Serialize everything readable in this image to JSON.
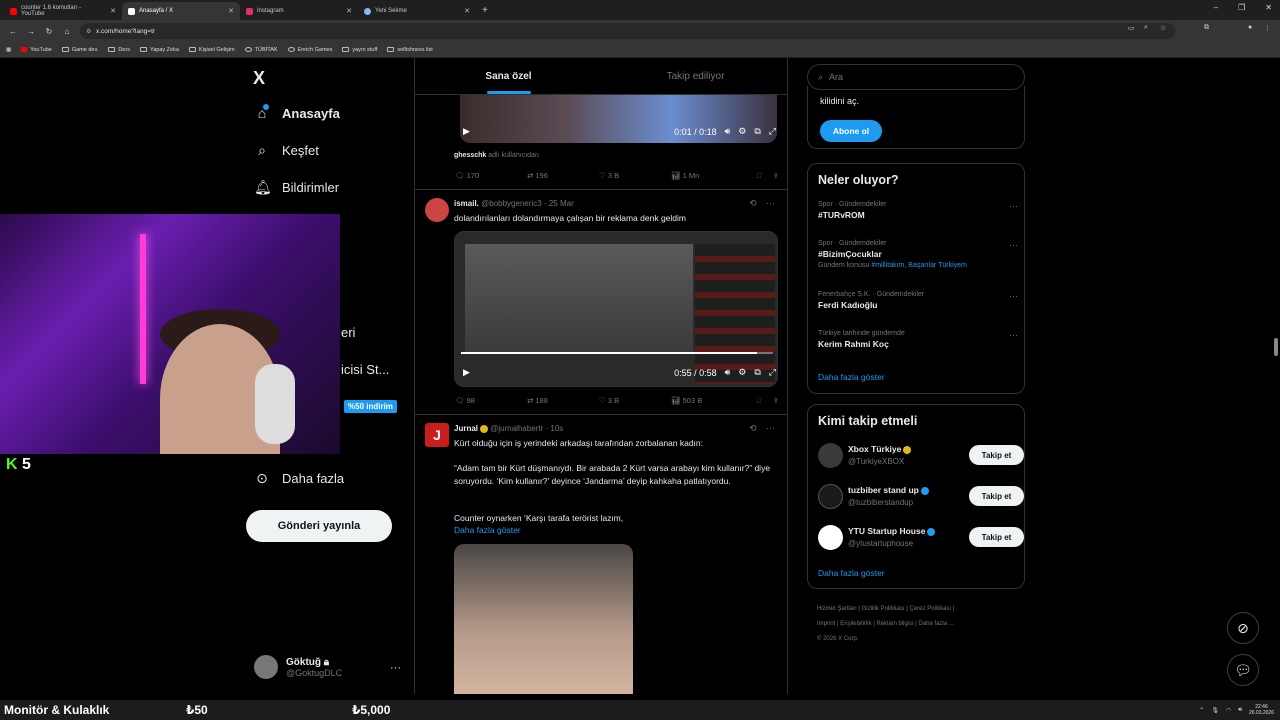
{
  "browser": {
    "tabs": [
      {
        "title": "counter 1.6 komutları - YouTube",
        "color": "#ff0000"
      },
      {
        "title": "Anasayfa / X",
        "color": "#ffffff"
      },
      {
        "title": "Instagram",
        "color": "#e1306c"
      },
      {
        "title": "Yeni Sekme",
        "color": "#8ab4f8"
      }
    ],
    "url": "x.com/home?lang=tr",
    "bookmarks": [
      "YouTube",
      "Game dev.",
      "Ders",
      "Yapay Zeka",
      "Kişisel Gelişim",
      "TÜBİTAK",
      "Enrich Games",
      "yayın stuff",
      "selfishness list"
    ]
  },
  "sidebar": {
    "logo": "X",
    "nav": [
      {
        "label": "Anasayfa",
        "icon": "home-icon"
      },
      {
        "label": "Keşfet",
        "icon": "search-icon"
      },
      {
        "label": "Bildirimler",
        "icon": "bell-icon"
      }
    ],
    "partial_1": "eri",
    "partial_2": "icisi St...",
    "promo_badge": "%50 indirim",
    "more": "Daha fazla",
    "post_button": "Gönderi yayınla",
    "account": {
      "name": "Göktuğ",
      "handle": "@GoktugDLC"
    }
  },
  "overlay": {
    "kick_value": "5"
  },
  "feed": {
    "tabs": [
      "Sana özel",
      "Takip ediliyor"
    ],
    "video1": {
      "time": "0:01 / 0:18",
      "attribution": "ghesschk",
      "attribution_suffix": "adlı kullanıcıdan",
      "progress": 0.05
    },
    "post1_stats": {
      "replies": "170",
      "reposts": "196",
      "likes": "3 B",
      "views": "1 Mn"
    },
    "post2": {
      "name": "ismail.",
      "handle": "@bobbygeneric3",
      "date": "25 Mar",
      "text": "dolandırılanları dolandırmaya çalışan bir reklama denk geldim",
      "video_time": "0:55 / 0:58",
      "progress": 0.95,
      "stats": {
        "replies": "98",
        "reposts": "188",
        "likes": "3 B",
        "views": "503 B"
      }
    },
    "post3": {
      "name": "Jurnal",
      "handle": "@jurnalhabertr",
      "time": "10s",
      "line1": "Kürt olduğu için iş yerindeki arkadaşı tarafından zorbalanan kadın:",
      "line2": "“Adam tam bir Kürt düşmanıydı. Bir arabada 2 Kürt varsa arabayı kim kullanır?” diye soruyordu. ‘Kim kullanır?’ deyince ‘Jandarma’ deyip kahkaha patlatıyordu.",
      "line3": "Counter oynarken ‘Karşı tarafa terörist lazım,",
      "show_more": "Daha fazla göster"
    }
  },
  "right": {
    "search_placeholder": "Ara",
    "premium_text": "kilidini aç.",
    "subscribe": "Abone ol",
    "trends_title": "Neler oluyor?",
    "trends": [
      {
        "category": "Spor · Gündemdekiler",
        "name": "#TURvROM",
        "extra": ""
      },
      {
        "category": "Spor · Gündemdekiler",
        "name": "#BizimÇocuklar",
        "extra_prefix": "Gündem konusu",
        "extra": "#millitakım, Başarılar Türkiyem"
      },
      {
        "category": "Fenerbahçe S.K. · Gündemdekiler",
        "name": "Ferdi Kadıoğlu",
        "extra": ""
      },
      {
        "category": "Türkiye tarihinde gündemde",
        "name": "Kerim Rahmi Koç",
        "extra": ""
      }
    ],
    "show_more": "Daha fazla göster",
    "who_title": "Kimi takip etmeli",
    "who": [
      {
        "name": "Xbox Türkiye",
        "handle": "@TurkiyeXBOX",
        "color": "#3a3a3a"
      },
      {
        "name": "tuzbiber stand up",
        "handle": "@tuzbiberstandup",
        "color": "#1a1a1a"
      },
      {
        "name": "YTU Startup House",
        "handle": "@ytustartuphouse",
        "color": "#ffffff"
      }
    ],
    "follow": "Takip et",
    "footer": [
      "Hizmet Şartları",
      "Gizlilik Politikası",
      "Çerez Politikası",
      "Imprint",
      "Erişilebilirlik",
      "Reklam bilgisi",
      "Daha fazla ...",
      "© 2026 X Corp."
    ]
  },
  "taskbar": {
    "label": "Monitör & Kulaklık",
    "price1": "₺50",
    "price2": "₺5,000",
    "time": "22:46",
    "date": "26.03.2026"
  }
}
